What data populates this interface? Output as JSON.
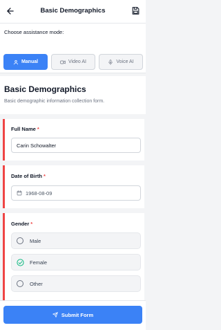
{
  "header": {
    "title": "Basic Demographics",
    "back_icon": "arrow-left-icon",
    "save_icon": "save-icon"
  },
  "assistance": {
    "label": "Choose assistance mode:",
    "modes": [
      {
        "label": "Manual",
        "icon": "user-icon",
        "active": true
      },
      {
        "label": "Video AI",
        "icon": "video-icon",
        "active": false
      },
      {
        "label": "Voice AI",
        "icon": "mic-icon",
        "active": false
      }
    ]
  },
  "form": {
    "title": "Basic Demographics",
    "description": "Basic demographic information collection form.",
    "full_name": {
      "label": "Full Name",
      "required_mark": "*",
      "value": "Carin Schowalter"
    },
    "dob": {
      "label": "Date of Birth",
      "required_mark": "*",
      "value": "1968-08-09",
      "icon": "calendar-icon"
    },
    "gender": {
      "label": "Gender",
      "required_mark": "*",
      "options": [
        "Male",
        "Female",
        "Other"
      ],
      "selected": "Female"
    }
  },
  "submit": {
    "label": "Submit Form",
    "icon": "send-icon"
  },
  "colors": {
    "accent": "#3b82f6",
    "required": "#ef4444",
    "selected_check": "#10b981"
  }
}
